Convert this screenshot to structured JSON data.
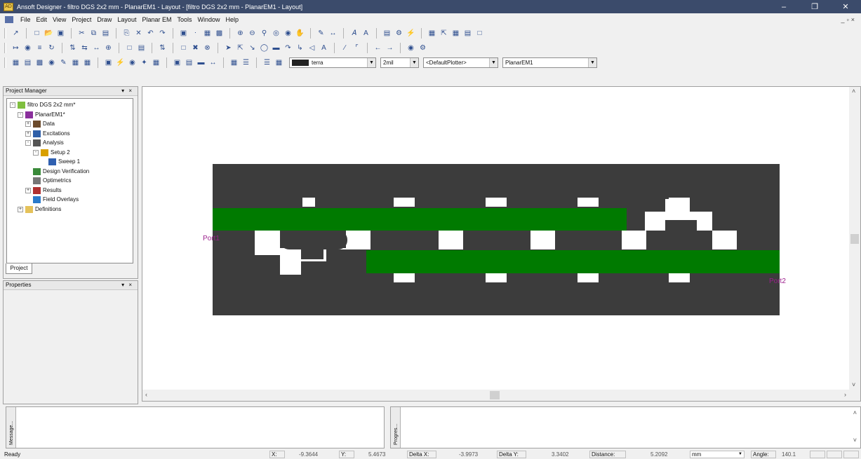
{
  "window": {
    "title": "Ansoft Designer - filtro DGS 2x2 mm - PlanarEM1 - Layout - [filtro DGS 2x2 mm - PlanarEM1 - Layout]"
  },
  "menu": [
    "File",
    "Edit",
    "View",
    "Project",
    "Draw",
    "Layout",
    "Planar EM",
    "Tools",
    "Window",
    "Help"
  ],
  "toolbar": {
    "layer_combo": "terra",
    "snap_combo": "2mil",
    "plotter_combo": "<DefaultPlotter>",
    "design_combo": "PlanarEM1"
  },
  "project_manager": {
    "title": "Project Manager",
    "tree": [
      {
        "label": "filtro DGS 2x2 mm*",
        "level": 0,
        "expander": "-",
        "icon": "project-icon"
      },
      {
        "label": "PlanarEM1*",
        "level": 1,
        "expander": "-",
        "icon": "planar-design-icon"
      },
      {
        "label": "Data",
        "level": 2,
        "expander": "+",
        "icon": "data-icon"
      },
      {
        "label": "Excitations",
        "level": 2,
        "expander": "+",
        "icon": "excitations-icon"
      },
      {
        "label": "Analysis",
        "level": 2,
        "expander": "-",
        "icon": "analysis-icon"
      },
      {
        "label": "Setup 2",
        "level": 3,
        "expander": "-",
        "icon": "setup-icon"
      },
      {
        "label": "Sweep 1",
        "level": 4,
        "expander": "",
        "icon": "sweep-icon"
      },
      {
        "label": "Design Verification",
        "level": 2,
        "expander": "",
        "icon": "design-verification-icon"
      },
      {
        "label": "Optimetrics",
        "level": 2,
        "expander": "",
        "icon": "optimetrics-icon"
      },
      {
        "label": "Results",
        "level": 2,
        "expander": "+",
        "icon": "results-icon"
      },
      {
        "label": "Field Overlays",
        "level": 2,
        "expander": "",
        "icon": "field-overlays-icon"
      },
      {
        "label": "Definitions",
        "level": 1,
        "expander": "+",
        "icon": "folder-icon"
      }
    ],
    "tab": "Project"
  },
  "properties": {
    "title": "Properties"
  },
  "layout": {
    "port1_label": "Port1",
    "port2_label": "Port2",
    "ground_color": "#3c3c3c",
    "trace_color": "#007a00",
    "slot_color": "#ffffff",
    "port_label_color": "#9b1f8c"
  },
  "message_pane": {
    "tab": "Message..."
  },
  "progress_pane": {
    "tab": "Progres..."
  },
  "status": {
    "ready": "Ready",
    "x_label": "X:",
    "x_value": "-9.3644",
    "y_label": "Y:",
    "y_value": "5.4673",
    "dx_label": "Delta X:",
    "dx_value": "-3.9973",
    "dy_label": "Delta Y:",
    "dy_value": "3.3402",
    "distance_label": "Distance:",
    "distance_value": "5.2092",
    "units": "mm",
    "angle_label": "Angle:",
    "angle_value": "140.1"
  }
}
